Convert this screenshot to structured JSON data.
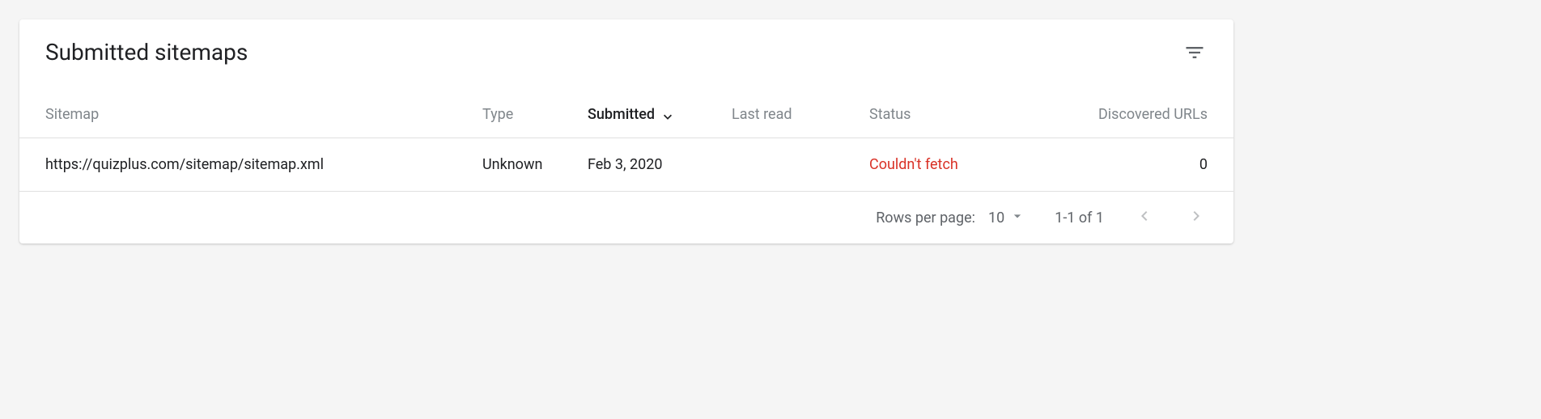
{
  "header": {
    "title": "Submitted sitemaps"
  },
  "table": {
    "columns": {
      "sitemap": "Sitemap",
      "type": "Type",
      "submitted": "Submitted",
      "last_read": "Last read",
      "status": "Status",
      "discovered_urls": "Discovered URLs"
    },
    "rows": [
      {
        "sitemap": "https://quizplus.com/sitemap/sitemap.xml",
        "type": "Unknown",
        "submitted": "Feb 3, 2020",
        "last_read": "",
        "status": "Couldn't fetch",
        "discovered_urls": "0"
      }
    ]
  },
  "pagination": {
    "rows_per_page_label": "Rows per page:",
    "rows_per_page_value": "10",
    "range": "1-1 of 1"
  }
}
